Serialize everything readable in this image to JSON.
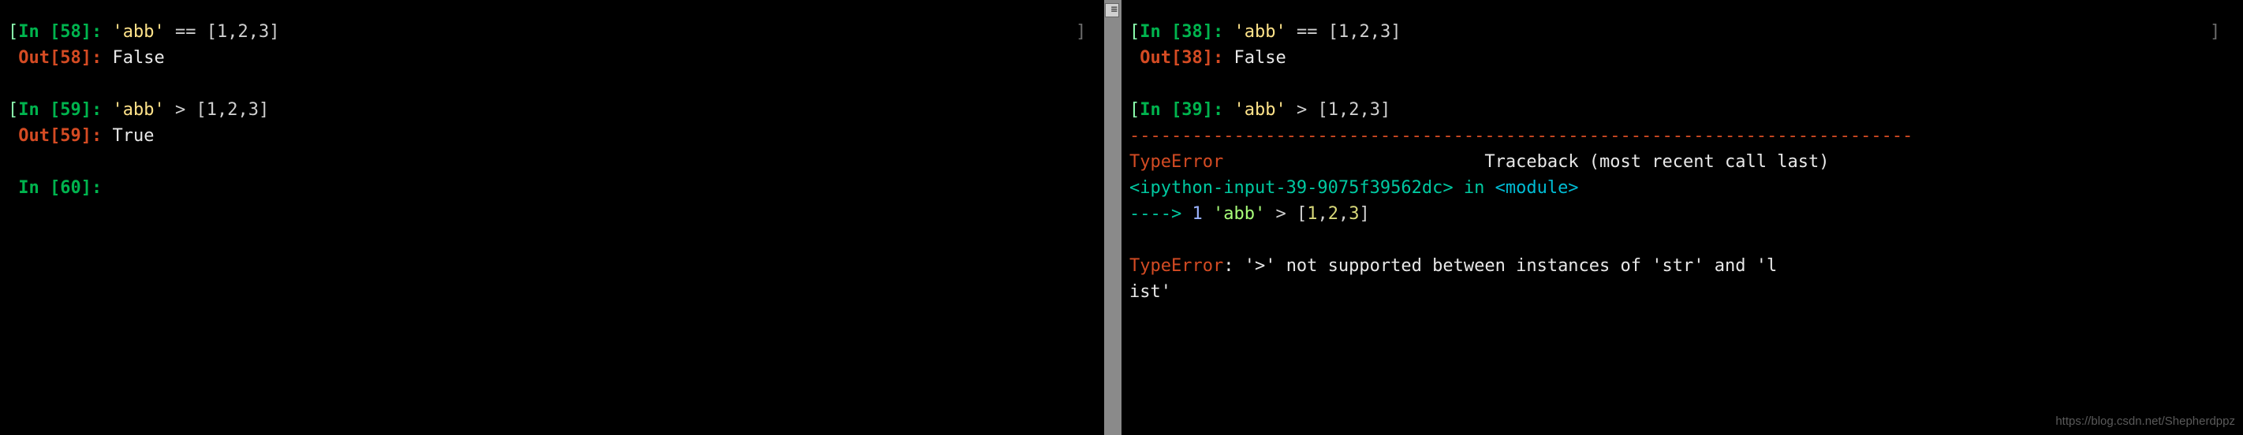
{
  "left": {
    "cells": [
      {
        "in_num": "58",
        "code_str": "'abb'",
        "op": "==",
        "list": "[1,2,3]",
        "out_num": "58",
        "out_val": "False"
      },
      {
        "in_num": "59",
        "code_str": "'abb'",
        "op": ">",
        "list": "[1,2,3]",
        "out_num": "59",
        "out_val": "True"
      }
    ],
    "prompt_num": "60"
  },
  "right": {
    "cell1": {
      "in_num": "38",
      "code_str": "'abb'",
      "op": "==",
      "list": "[1,2,3]",
      "out_num": "38",
      "out_val": "False"
    },
    "cell2": {
      "in_num": "39",
      "code_str": "'abb'",
      "op": ">",
      "list": "[1,2,3]"
    },
    "error": {
      "dashline": "---------------------------------------------------------------------------",
      "errtype": "TypeError",
      "traceback_label": "Traceback (most recent call last)",
      "source": "<ipython-input-39-9075f39562dc>",
      "in_word": " in ",
      "module": "<module>",
      "arrow": "----> ",
      "lineno": "1 ",
      "code_str": "'abb'",
      "code_op": " > ",
      "code_list_open": "[",
      "n1": "1",
      "c1": ",",
      "n2": "2",
      "c2": ",",
      "n3": "3",
      "code_list_close": "]",
      "final_label": "TypeError",
      "final_msg": ": '>' not supported between instances of 'str' and 'l",
      "final_msg2": "ist'"
    }
  },
  "watermark": "https://blog.csdn.net/Shepherdppz",
  "rbracket": "]"
}
